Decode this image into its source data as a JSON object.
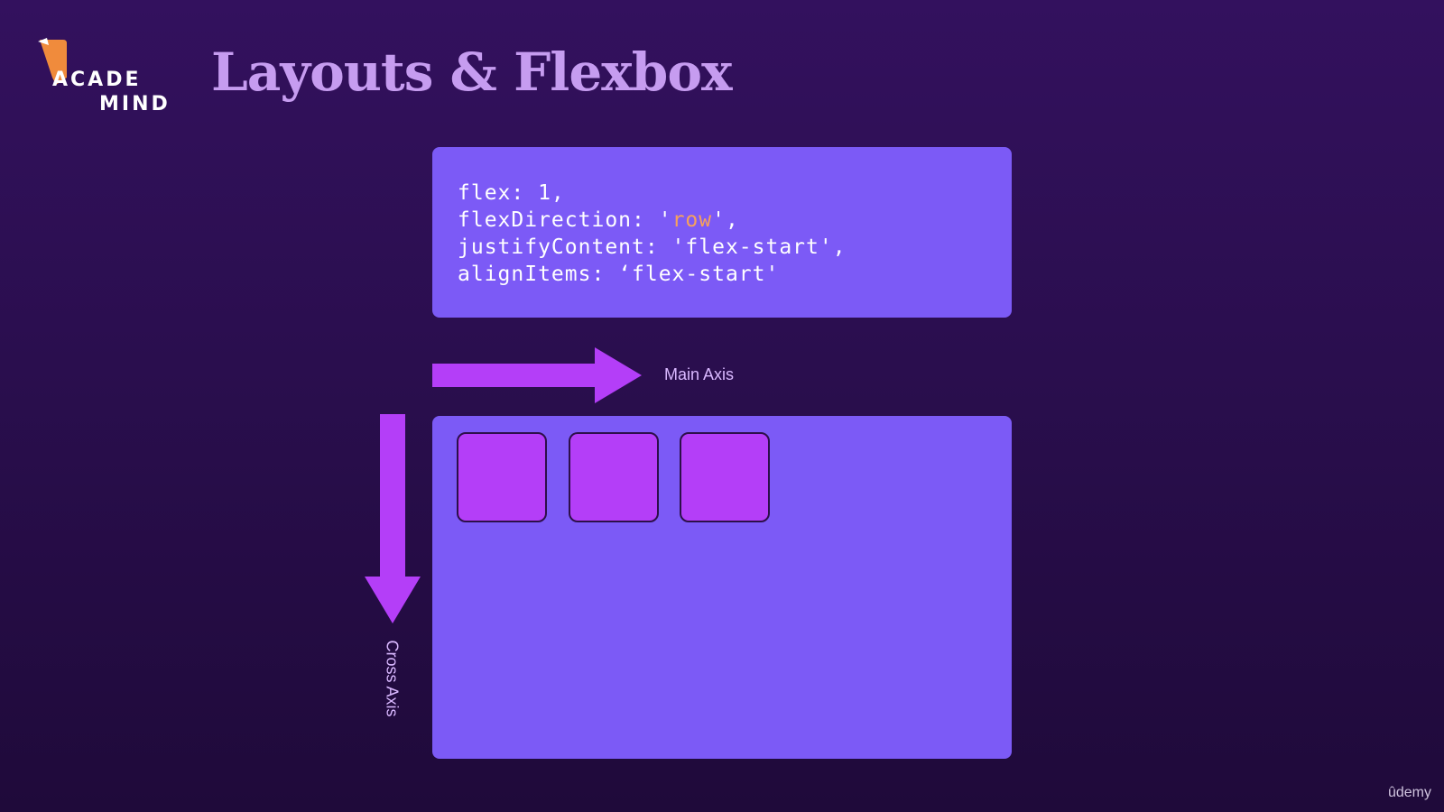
{
  "logo": {
    "line1": "ACADE",
    "line2": "MIND",
    "icon": "academind-flag-icon",
    "flag_color": "#f08b3c"
  },
  "slide": {
    "title": "Layouts & Flexbox"
  },
  "code": {
    "line1": "flex: 1,",
    "line2_prefix": "flexDirection: '",
    "line2_highlight": "row",
    "line2_suffix": "',",
    "line3": "justifyContent: 'flex-start',",
    "line4": "alignItems: ‘flex-start'"
  },
  "axes": {
    "main_label": "Main Axis",
    "cross_label": "Cross Axis",
    "arrow_color": "#b43ef8"
  },
  "flex_items": {
    "count": 3,
    "color": "#b43ef8"
  },
  "colors": {
    "card": "#7c5af6",
    "code_highlight": "#f7a15c",
    "title": "#c69cf0"
  },
  "watermark": "ûdemy"
}
